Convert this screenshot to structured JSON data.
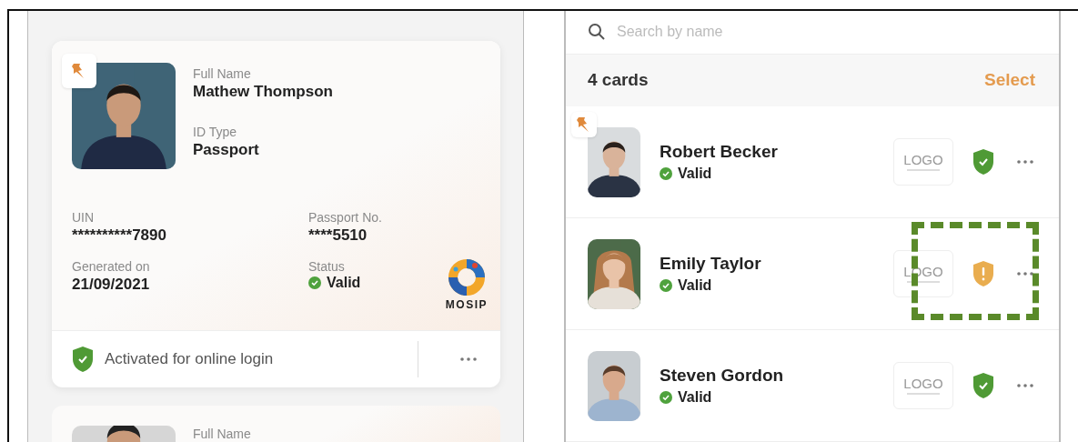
{
  "wallet": {
    "id_card": {
      "pinned": true,
      "top_fields": [
        {
          "label": "Full Name",
          "value": "Mathew Thompson"
        },
        {
          "label": "ID Type",
          "value": "Passport"
        }
      ],
      "grid_fields": [
        {
          "label": "UIN",
          "value": "**********7890"
        },
        {
          "label": "Passport No.",
          "value": "****5510"
        },
        {
          "label": "Generated on",
          "value": "21/09/2021"
        },
        {
          "label": "Status",
          "value": "Valid",
          "kind": "status"
        }
      ],
      "issuer_logo": "MOSIP",
      "footer": {
        "text": "Activated for online login",
        "shield_warning": false
      }
    },
    "next_card": {
      "label": "Full Name"
    }
  },
  "card_list": {
    "search": {
      "placeholder": "Search by name"
    },
    "count": "4 cards",
    "select": "Select",
    "cards": [
      {
        "name": "Robert Becker",
        "status": "Valid",
        "pinned": true,
        "shield_warning": false,
        "highlighted": false,
        "logo": "LOGO"
      },
      {
        "name": "Emily Taylor",
        "status": "Valid",
        "pinned": false,
        "shield_warning": true,
        "highlighted": true,
        "logo": "LOGO"
      },
      {
        "name": "Steven Gordon",
        "status": "Valid",
        "pinned": false,
        "shield_warning": false,
        "highlighted": false,
        "logo": "LOGO"
      }
    ]
  }
}
